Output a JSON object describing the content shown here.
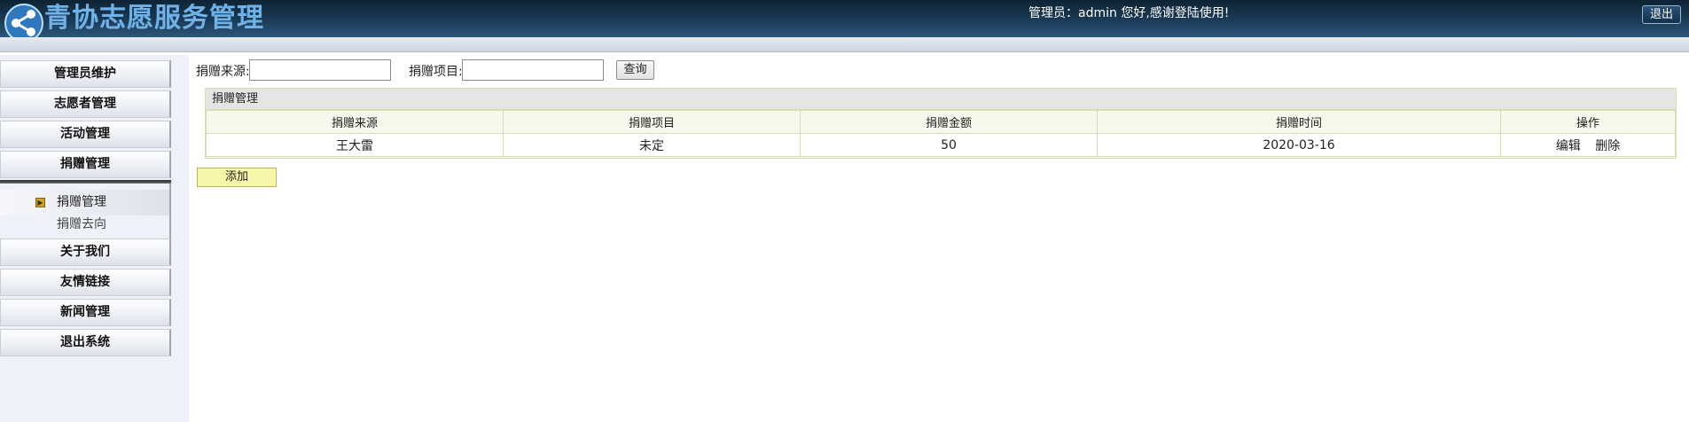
{
  "header": {
    "app_title": "青协志愿服务管理",
    "greeting": "管理员：admin 您好,感谢登陆使用!",
    "logout_label": "退出"
  },
  "sidebar": {
    "items": [
      {
        "label": "管理员维护"
      },
      {
        "label": "志愿者管理"
      },
      {
        "label": "活动管理"
      },
      {
        "label": "捐赠管理"
      }
    ],
    "submenu": {
      "active_label": "捐赠管理",
      "other_label": "捐赠去向"
    },
    "items_after": [
      {
        "label": "关于我们"
      },
      {
        "label": "友情链接"
      },
      {
        "label": "新闻管理"
      },
      {
        "label": "退出系统"
      }
    ]
  },
  "search": {
    "source_label": "捐赠来源:",
    "source_value": "",
    "project_label": "捐赠项目:",
    "project_value": "",
    "query_label": "查询"
  },
  "panel": {
    "title": "捐赠管理",
    "columns": [
      "捐赠来源",
      "捐赠项目",
      "捐赠金额",
      "捐赠时间",
      "操作"
    ],
    "rows": [
      {
        "source": "王大雷",
        "project": "未定",
        "amount": "50",
        "time": "2020-03-16",
        "edit_label": "编辑",
        "delete_label": "删除"
      }
    ]
  },
  "add_label": "添加",
  "colors": {
    "topbar": "#1a3b57",
    "title": "#6fb2e8",
    "table_border": "#d7ddb0",
    "add_button": "#f7f5a7"
  }
}
